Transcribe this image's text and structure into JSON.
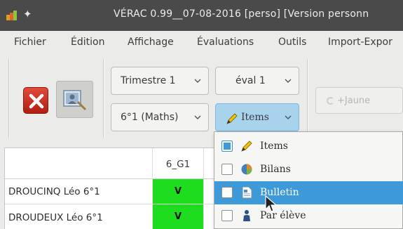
{
  "window": {
    "title": "VÉRAC  0.99__07-08-2016  [perso]  [Version personn"
  },
  "menubar": {
    "items": [
      "Fichier",
      "Édition",
      "Affichage",
      "Évaluations",
      "Outils",
      "Import-Expor"
    ]
  },
  "toolbar": {
    "period_combo": "Trimestre 1",
    "eval_combo": "éval 1",
    "class_combo": "6°1 (Maths)",
    "view_combo": "Items",
    "jaune_button": "+Jaune"
  },
  "table": {
    "column_header": "6_G1",
    "rows": [
      {
        "name": "DROUCINQ Léo 6°1",
        "value": "V"
      },
      {
        "name": "DROUDEUX Léo 6°1",
        "value": "V"
      }
    ]
  },
  "dropdown": {
    "items": [
      {
        "label": "Items",
        "checked": true,
        "icon": "pencil-icon",
        "highlighted": false
      },
      {
        "label": "Bilans",
        "checked": false,
        "icon": "pie-chart-icon",
        "highlighted": false
      },
      {
        "label": "Bulletin",
        "checked": false,
        "icon": "document-icon",
        "highlighted": true
      },
      {
        "label": "Par élève",
        "checked": false,
        "icon": "person-icon",
        "highlighted": false
      }
    ]
  },
  "colors": {
    "titlebar": "#4a4a4a",
    "highlight": "#3d99d8",
    "items_combo": "#a8d3ec",
    "cell_green": "#1edc1e"
  }
}
